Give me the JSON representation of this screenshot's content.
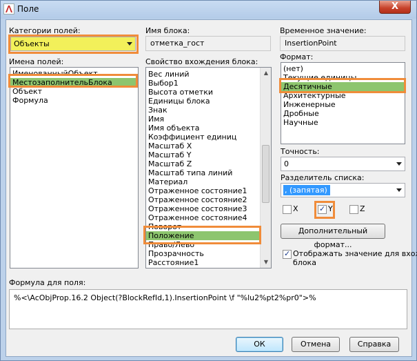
{
  "window": {
    "title": "Поле",
    "close_label": "X"
  },
  "field_categories": {
    "label": "Категории полей:",
    "selected": "Объекты"
  },
  "field_names": {
    "label": "Имена полей:",
    "items": [
      "ИменованныйОбъект",
      "МестозаполнительБлока",
      "Объект",
      "Формула"
    ],
    "selected_index": 1
  },
  "block_name": {
    "label": "Имя блока:",
    "value": "отметка_гост"
  },
  "block_property": {
    "label": "Свойство вхождения блока:",
    "items": [
      "Вес линий",
      "Выбор1",
      "Высота отметки",
      "Единицы блока",
      "Знак",
      "Имя",
      "Имя объекта",
      "Коэффициент единиц",
      "Масштаб X",
      "Масштаб Y",
      "Масштаб Z",
      "Масштаб типа линий",
      "Материал",
      "Отраженное состояние1",
      "Отраженное состояние2",
      "Отраженное состояние3",
      "Отраженное состояние4",
      "Поворот",
      "Положение",
      "Право/Лево",
      "Прозрачность",
      "Расстояние1"
    ],
    "selected_index": 18
  },
  "temp_value": {
    "label": "Временное значение:",
    "value": "InsertionPoint"
  },
  "format": {
    "label": "Формат:",
    "items": [
      "(нет)",
      "Текущие единицы",
      "Десятичные",
      "Архитектурные",
      "Инженерные",
      "Дробные",
      "Научные"
    ],
    "selected_index": 2
  },
  "precision": {
    "label": "Точность:",
    "selected": "0"
  },
  "list_separator": {
    "label": "Разделитель списка:",
    "selected_highlight": ",",
    "selected_rest": " (запятая)"
  },
  "axes": {
    "x_label": "X",
    "x_checked": false,
    "y_label": "Y",
    "y_checked": true,
    "z_label": "Z",
    "z_checked": false
  },
  "additional_format_button": "Дополнительный формат...",
  "show_value": {
    "label_line1": "Отображать значение для вхожд",
    "label_line2": "блока",
    "checked": true
  },
  "formula": {
    "label": "Формула для поля:",
    "value": "%<\\AcObjProp.16.2 Object(?BlockRefId,1).InsertionPoint \\f \"%lu2%pt2%pr0\">%"
  },
  "buttons": {
    "ok": "ОК",
    "cancel": "Отмена",
    "help": "Справка"
  },
  "colors": {
    "highlight_frame": "#f08c3a",
    "selection_green": "#8dc56e",
    "combo_yellow": "#f2f05a",
    "selection_blue": "#3399ff"
  }
}
